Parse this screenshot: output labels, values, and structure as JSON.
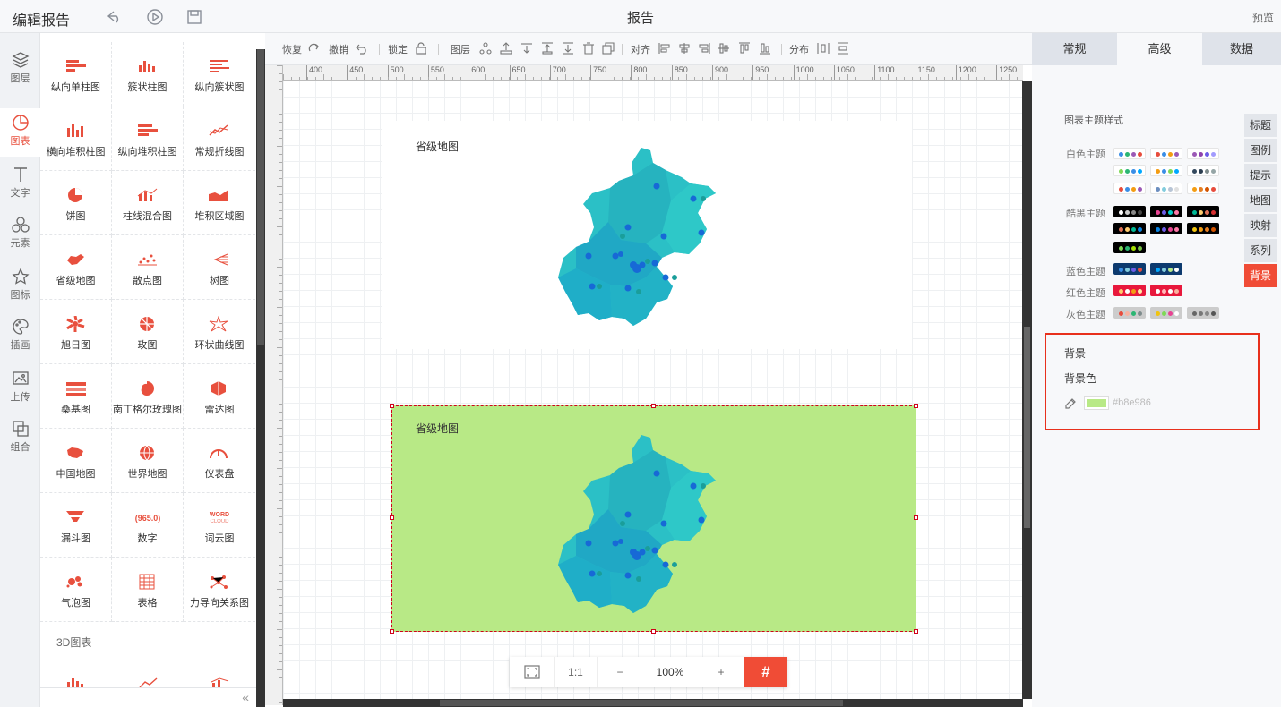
{
  "topbar": {
    "app_title": "编辑报告",
    "doc_title": "报告",
    "preview": "预览"
  },
  "leftnav": {
    "items": [
      {
        "label": "图层",
        "icon": "layers-icon"
      },
      {
        "label": "图表",
        "icon": "chart-icon"
      },
      {
        "label": "文字",
        "icon": "text-icon"
      },
      {
        "label": "元素",
        "icon": "shapes-icon"
      },
      {
        "label": "图标",
        "icon": "star-icon"
      },
      {
        "label": "插画",
        "icon": "palette-icon"
      },
      {
        "label": "上传",
        "icon": "upload-image-icon"
      },
      {
        "label": "组合",
        "icon": "group-icon"
      }
    ]
  },
  "components": {
    "items": [
      "纵向单柱图",
      "簇状柱图",
      "纵向簇状图",
      "横向堆积柱图",
      "纵向堆积柱图",
      "常规折线图",
      "饼图",
      "柱线混合图",
      "堆积区域图",
      "省级地图",
      "散点图",
      "树图",
      "旭日图",
      "玫图",
      "环状曲线图",
      "桑基图",
      "南丁格尔玫瑰图",
      "雷达图",
      "中国地图",
      "世界地图",
      "仪表盘",
      "漏斗图",
      "数字",
      "词云图",
      "气泡图",
      "表格",
      "力导向关系图"
    ],
    "section_3d": "3D图表",
    "number_icon_text": "965.0",
    "wordcloud_icon_text": [
      "WORD",
      "CLOUD"
    ],
    "accent": "#e8503e"
  },
  "toolbar": {
    "redo": "恢复",
    "undo": "撤销",
    "lock": "锁定",
    "layer": "图层",
    "align": "对齐",
    "distribute": "分布"
  },
  "ruler": {
    "marks": [
      "400",
      "450",
      "500",
      "550",
      "600",
      "650",
      "700",
      "750",
      "800",
      "850",
      "900",
      "950",
      "1000",
      "1050",
      "1100",
      "1150",
      "1200",
      "1250"
    ]
  },
  "canvas": {
    "chart1_title": "省级地图",
    "chart2_title": "省级地图",
    "chart2_bg": "#b8e986"
  },
  "zoom": {
    "fit": "",
    "one_to_one": "1:1",
    "minus": "−",
    "level": "100%",
    "plus": "+",
    "grid": "#"
  },
  "rpanel": {
    "tabs": [
      "常规",
      "高级",
      "数据"
    ],
    "active_tab": "高级",
    "theme_title": "图表主题样式",
    "theme_labels": [
      "白色主题",
      "酷黑主题",
      "蓝色主题",
      "红色主题",
      "灰色主题"
    ],
    "side_tabs": [
      "标题",
      "图例",
      "提示",
      "地图",
      "映射",
      "系列",
      "背景"
    ],
    "active_side_tab": "背景",
    "bg_heading": "背景",
    "bg_color_label": "背景色",
    "bg_color_value": "#b8e986"
  }
}
